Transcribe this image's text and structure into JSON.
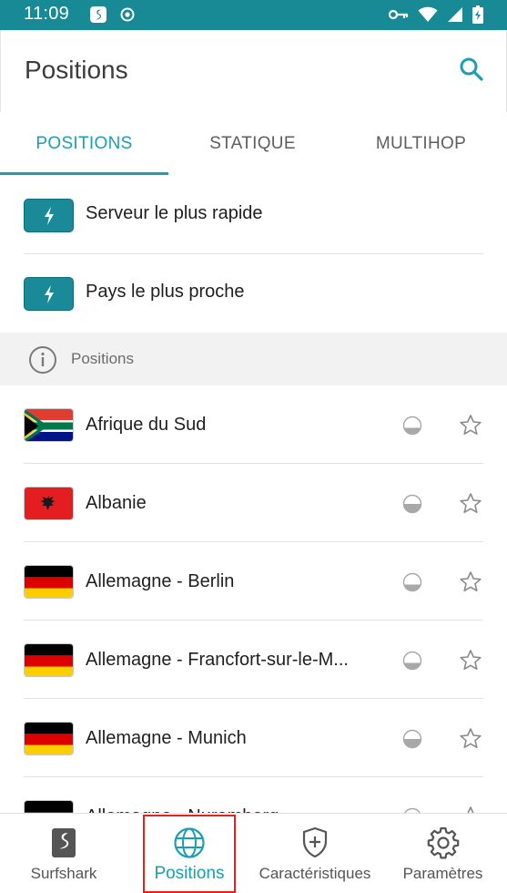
{
  "status_bar": {
    "time": "11:09",
    "icons_left": [
      "surfshark-notif-icon",
      "record-icon"
    ],
    "icons_right": [
      "vpn-key-icon",
      "wifi-icon",
      "signal-icon",
      "battery-charging-icon"
    ]
  },
  "app_bar": {
    "title": "Positions",
    "search_icon": "search-icon"
  },
  "tabs": [
    {
      "label": "POSITIONS",
      "active": true
    },
    {
      "label": "STATIQUE",
      "active": false
    },
    {
      "label": "MULTIHOP",
      "active": false
    }
  ],
  "quick_connect": [
    {
      "label": "Serveur le plus rapide",
      "icon": "bolt-icon"
    },
    {
      "label": "Pays le plus proche",
      "icon": "bolt-icon"
    }
  ],
  "section": {
    "label": "Positions",
    "icon": "info-icon"
  },
  "locations": [
    {
      "label": "Afrique du Sud",
      "flag": "south-africa"
    },
    {
      "label": "Albanie",
      "flag": "albania"
    },
    {
      "label": "Allemagne - Berlin",
      "flag": "germany"
    },
    {
      "label": "Allemagne - Francfort-sur-le-M...",
      "flag": "germany"
    },
    {
      "label": "Allemagne - Munich",
      "flag": "germany"
    },
    {
      "label": "Allemagne - Nuremberg",
      "flag": "germany"
    }
  ],
  "bottom_nav": [
    {
      "label": "Surfshark",
      "icon": "surfshark-logo-icon",
      "active": false
    },
    {
      "label": "Positions",
      "icon": "globe-icon",
      "active": true
    },
    {
      "label": "Caractéristiques",
      "icon": "shield-plus-icon",
      "active": false
    },
    {
      "label": "Paramètres",
      "icon": "gear-icon",
      "active": false
    }
  ],
  "colors": {
    "accent": "#1a9fb0",
    "status_bar": "#178a96",
    "highlight": "#e8201c"
  }
}
